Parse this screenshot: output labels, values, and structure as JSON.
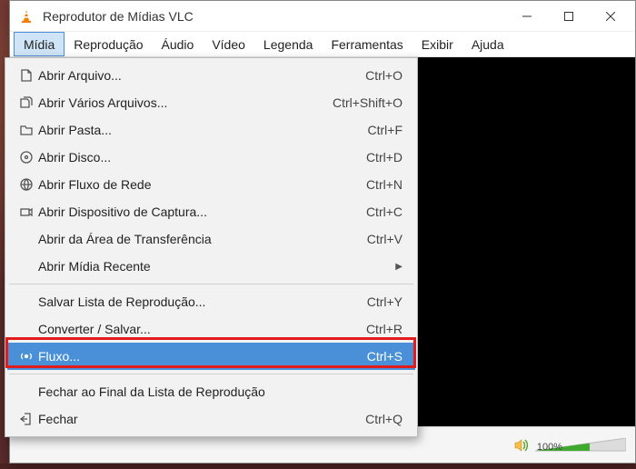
{
  "title": "Reprodutor de Mídias VLC",
  "menubar": {
    "items": [
      {
        "label": "Mídia",
        "active": true
      },
      {
        "label": "Reprodução"
      },
      {
        "label": "Áudio"
      },
      {
        "label": "Vídeo"
      },
      {
        "label": "Legenda"
      },
      {
        "label": "Ferramentas"
      },
      {
        "label": "Exibir"
      },
      {
        "label": "Ajuda"
      }
    ]
  },
  "volume": {
    "pct": "100%"
  },
  "menu": {
    "items": [
      {
        "icon": "file",
        "label": "Abrir Arquivo...",
        "shortcut": "Ctrl+O"
      },
      {
        "icon": "files",
        "label": "Abrir Vários Arquivos...",
        "shortcut": "Ctrl+Shift+O"
      },
      {
        "icon": "folder",
        "label": "Abrir Pasta...",
        "shortcut": "Ctrl+F"
      },
      {
        "icon": "disc",
        "label": "Abrir Disco...",
        "shortcut": "Ctrl+D"
      },
      {
        "icon": "net",
        "label": "Abrir Fluxo de Rede",
        "shortcut": "Ctrl+N"
      },
      {
        "icon": "capture",
        "label": "Abrir Dispositivo de Captura...",
        "shortcut": "Ctrl+C"
      },
      {
        "icon": "",
        "label": "Abrir da Área de Transferência",
        "shortcut": "Ctrl+V"
      },
      {
        "icon": "",
        "label": "Abrir Mídia Recente",
        "shortcut": "",
        "submenu": true
      },
      {
        "sep": true
      },
      {
        "icon": "",
        "label": "Salvar Lista de Reprodução...",
        "shortcut": "Ctrl+Y"
      },
      {
        "icon": "",
        "label": "Converter / Salvar...",
        "shortcut": "Ctrl+R"
      },
      {
        "icon": "stream",
        "label": "Fluxo...",
        "shortcut": "Ctrl+S",
        "highlight": true
      },
      {
        "sep": true
      },
      {
        "icon": "",
        "label": "Fechar ao Final da Lista de Reprodução",
        "shortcut": ""
      },
      {
        "icon": "exit",
        "label": "Fechar",
        "shortcut": "Ctrl+Q"
      }
    ]
  }
}
